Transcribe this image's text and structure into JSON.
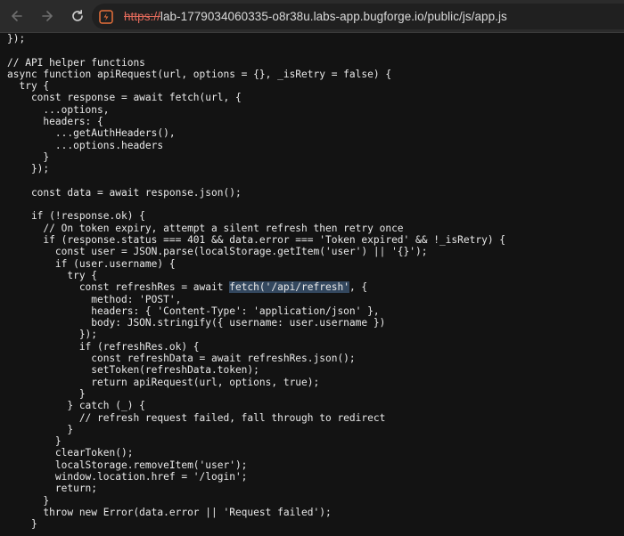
{
  "toolbar": {
    "url_scheme": "https://",
    "url_rest": "lab-1779034060335-o8r38u.labs-app.bugforge.io/public/js/app.js"
  },
  "code": {
    "lines": [
      "});",
      "",
      "// API helper functions",
      "async function apiRequest(url, options = {}, _isRetry = false) {",
      "  try {",
      "    const response = await fetch(url, {",
      "      ...options,",
      "      headers: {",
      "        ...getAuthHeaders(),",
      "        ...options.headers",
      "      }",
      "    });",
      "",
      "    const data = await response.json();",
      "",
      "    if (!response.ok) {",
      "      // On token expiry, attempt a silent refresh then retry once",
      "      if (response.status === 401 && data.error === 'Token expired' && !_isRetry) {",
      "        const user = JSON.parse(localStorage.getItem('user') || '{}');",
      "        if (user.username) {",
      "          try {",
      "            const refreshRes = await fetch('/api/refresh', {",
      "              method: 'POST',",
      "              headers: { 'Content-Type': 'application/json' },",
      "              body: JSON.stringify({ username: user.username })",
      "            });",
      "            if (refreshRes.ok) {",
      "              const refreshData = await refreshRes.json();",
      "              setToken(refreshData.token);",
      "              return apiRequest(url, options, true);",
      "            }",
      "          } catch (_) {",
      "            // refresh request failed, fall through to redirect",
      "          }",
      "        }",
      "        clearToken();",
      "        localStorage.removeItem('user');",
      "        window.location.href = '/login';",
      "        return;",
      "      }",
      "      throw new Error(data.error || 'Request failed');",
      "    }"
    ],
    "highlight": "fetch('/api/refresh'",
    "highlight_line": 21
  }
}
